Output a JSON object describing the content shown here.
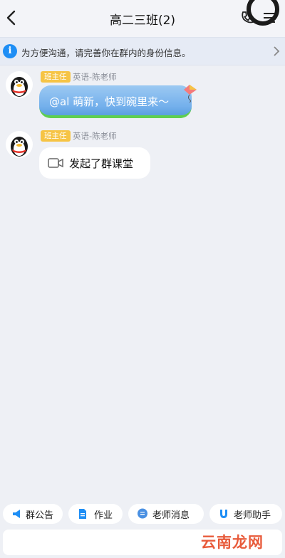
{
  "header": {
    "title": "高二三班(2)"
  },
  "notice": {
    "text": "为方便沟通，请完善你在群内的身份信息。"
  },
  "messages": [
    {
      "badge": "班主任",
      "sender": "英语-陈老师",
      "text": "@al 萌新，快到碗里来～",
      "style": "blue"
    },
    {
      "badge": "班主任",
      "sender": "英语-陈老师",
      "text": "发起了群课堂",
      "style": "white"
    }
  ],
  "toolbar": {
    "items": [
      {
        "label": "群公告",
        "icon": "megaphone-icon"
      },
      {
        "label": "作业",
        "icon": "document-icon"
      },
      {
        "label": "老师消息",
        "icon": "chat-icon"
      },
      {
        "label": "老师助手",
        "icon": "magnet-icon"
      }
    ]
  },
  "watermark": "云南龙网",
  "colors": {
    "accent": "#1e8ef5",
    "badge": "#f6c445",
    "background": "#eef0f5"
  }
}
